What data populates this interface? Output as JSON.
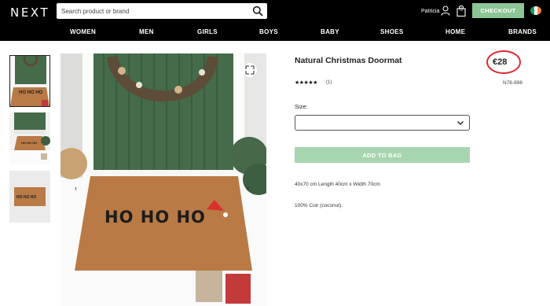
{
  "header": {
    "logo": "NEXT",
    "search_placeholder": "Search product or brand",
    "user_name": "Patricia",
    "bag_count": "0",
    "checkout_label": "CHECKOUT",
    "flag_colors": [
      "#169b62",
      "#ffffff",
      "#ff883e"
    ]
  },
  "nav": {
    "items": [
      "WOMEN",
      "MEN",
      "GIRLS",
      "BOYS",
      "BABY",
      "SHOES",
      "HOME",
      "BRANDS"
    ]
  },
  "product": {
    "title": "Natural Christmas Doormat",
    "price": "€28",
    "rating_stars": "★★★★★",
    "review_count": "(1)",
    "code": "N78-896",
    "size_label": "Size:",
    "size_value": "",
    "add_to_bag_label": "ADD TO BAG",
    "dimensions": "40x70 cm Length 40cm x Width 70cm",
    "material": "100% Coir (coconut).",
    "mat_text": "HO HO HO",
    "thumb_mat_text": "HO HO HO"
  },
  "colors": {
    "checkout_green": "#8cc596",
    "add_to_bag_green": "#a7d5af",
    "price_circle": "#e0262f",
    "door_green": "#456b4a",
    "mat_brown": "#b97a45"
  },
  "icons": {
    "search": "search-icon",
    "user": "user-icon",
    "bag": "shopping-bag-icon",
    "expand": "expand-icon",
    "chevron": "chevron-down-icon"
  }
}
